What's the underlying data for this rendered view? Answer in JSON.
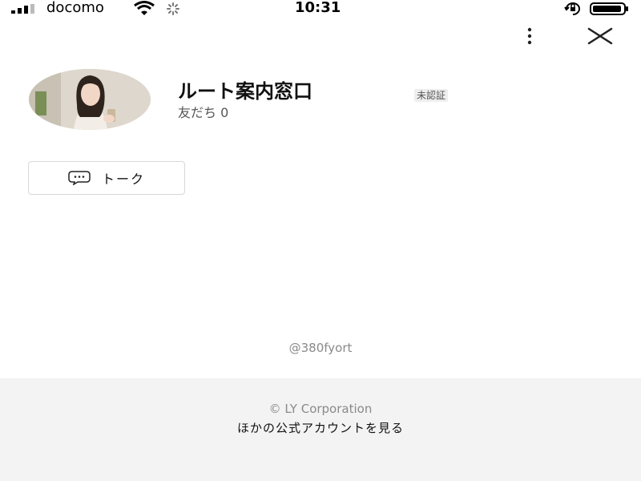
{
  "status_bar": {
    "carrier": "docomo",
    "time": "10:31",
    "icons": [
      "signal-icon",
      "wifi-icon",
      "loading-icon",
      "rotation-lock-icon",
      "battery-icon"
    ]
  },
  "header": {
    "icons": [
      "more-vertical-icon",
      "close-icon"
    ]
  },
  "profile": {
    "avatar_icon": "avatar",
    "name": "ルート案内窓口",
    "badge": "未認証",
    "friends": "友だち 0"
  },
  "talk_button": {
    "icon": "chat-bubble-icon",
    "label": "トーク"
  },
  "account_id": "@380fyort",
  "footer": {
    "copyright": "© LY Corporation",
    "other_accounts_link": "ほかの公式アカウントを見る",
    "background": "#f3f3f3"
  }
}
